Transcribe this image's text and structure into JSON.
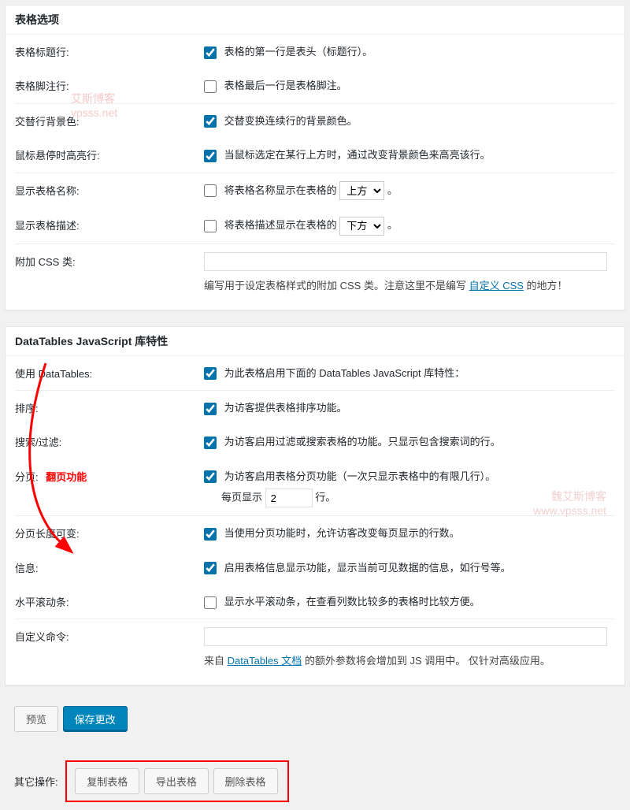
{
  "panel1": {
    "title": "表格选项",
    "table_header_label": "表格标题行:",
    "table_header_check": "表格的第一行是表头（标题行）。",
    "table_footer_label": "表格脚注行:",
    "table_footer_check": "表格最后一行是表格脚注。",
    "alt_rows_label": "交替行背景色:",
    "alt_rows_check": "交替变换连续行的背景颜色。",
    "hover_label": "鼠标悬停时高亮行:",
    "hover_check": "当鼠标选定在某行上方时，通过改变背景颜色来高亮该行。",
    "show_name_label": "显示表格名称:",
    "show_name_check": "将表格名称显示在表格的",
    "show_name_select": "上方",
    "show_name_period": "。",
    "show_desc_label": "显示表格描述:",
    "show_desc_check": "将表格描述显示在表格的",
    "show_desc_select": "下方",
    "show_desc_period": "。",
    "extra_css_label": "附加 CSS 类:",
    "extra_css_desc_before": "编写用于设定表格样式的附加 CSS 类。注意这里不是编写 ",
    "extra_css_link": "自定义 CSS",
    "extra_css_desc_after": " 的地方！"
  },
  "panel2": {
    "title": "DataTables JavaScript 库特性",
    "use_dt_label": "使用 DataTables:",
    "use_dt_check": "为此表格启用下面的 DataTables JavaScript 库特性：",
    "sort_label": "排序:",
    "sort_check": "为访客提供表格排序功能。",
    "search_label": "搜索/过滤:",
    "search_check": "为访客启用过滤或搜索表格的功能。只显示包含搜索词的行。",
    "paging_label": "分页:",
    "paging_check": "为访客启用表格分页功能（一次只显示表格中的有限几行）。",
    "per_page_before": "每页显示",
    "per_page_value": "2",
    "per_page_after": "行。",
    "paging_annotation": "翻页功能",
    "length_label": "分页长度可变:",
    "length_check": "当使用分页功能时，允许访客改变每页显示的行数。",
    "info_label": "信息:",
    "info_check": "启用表格信息显示功能，显示当前可见数据的信息，如行号等。",
    "hscroll_label": "水平滚动条:",
    "hscroll_check": "显示水平滚动条，在查看列数比较多的表格时比较方便。",
    "custom_cmd_label": "自定义命令:",
    "custom_cmd_before": "来自 ",
    "custom_cmd_link": "DataTables 文档",
    "custom_cmd_after": " 的额外参数将会增加到 JS 调用中。 仅针对高级应用。"
  },
  "actions": {
    "preview": "预览",
    "save": "保存更改"
  },
  "other": {
    "label": "其它操作:",
    "copy": "复制表格",
    "export": "导出表格",
    "delete": "删除表格"
  },
  "watermark": {
    "line1b": "艾斯博客",
    "line2": "vpsss.net",
    "line1c": "魏艾斯博客",
    "line2c": "www.vpsss.net"
  }
}
